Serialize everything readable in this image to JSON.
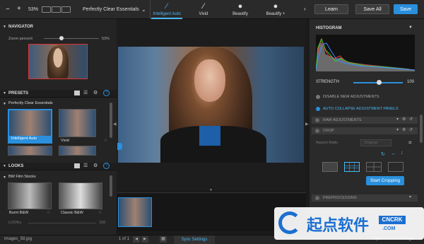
{
  "topbar": {
    "plus": "+",
    "minus": "−",
    "zoom": "53%",
    "preset_name": "Perfectly Clear Essentials",
    "tools": [
      {
        "label": "Intelligent Auto",
        "icon": "brush-icon"
      },
      {
        "label": "Vivid",
        "icon": "brush-icon"
      },
      {
        "label": "Beautify",
        "icon": "face-icon"
      },
      {
        "label": "Beautify +",
        "icon": "face-icon"
      }
    ],
    "learn": "Learn",
    "save_all": "Save All",
    "save": "Save"
  },
  "navigator": {
    "title": "NAVIGATOR",
    "zoom_label": "Zoom percent",
    "zoom_value": "53%"
  },
  "presets": {
    "title": "PRESETS",
    "group": "Perfectly Clear Essentials",
    "items": [
      {
        "label": "Intelligent Auto"
      },
      {
        "label": "Vivid"
      }
    ]
  },
  "looks": {
    "title": "LOOKS",
    "group": "BW Film Stocks",
    "items": [
      {
        "label": "Burnt B&W"
      },
      {
        "label": "Classic B&W"
      }
    ],
    "strength_label": "LOOKs",
    "strength_value": "100"
  },
  "histogram": {
    "title": "HISTOGRAM"
  },
  "strength": {
    "label": "STRENGTH",
    "value": "100"
  },
  "options": {
    "disable": "DISABLE NEW ADJUSTMENTS",
    "auto_collapse": "AUTO COLLAPSE ADJUSTMENT PANELS"
  },
  "sections": {
    "raw": "RAW ADJUSTMENTS",
    "crop": "CROP",
    "aspect_label": "Aspect Ratio",
    "aspect_value": "Original",
    "start_cropping": "Start Cropping",
    "preprocessing": "PREPROCESSING"
  },
  "bottom": {
    "filename": "images_58.jpg",
    "page": "1 of 1",
    "sync": "Sync Settings",
    "open_manage": "Open Preset Manager"
  },
  "watermark": {
    "text": "起点软件",
    "domain": "CNCRK",
    "domain_sub": ".COM"
  },
  "colors": {
    "accent": "#2a8fdc",
    "active_tool": "#4ab8f5"
  }
}
